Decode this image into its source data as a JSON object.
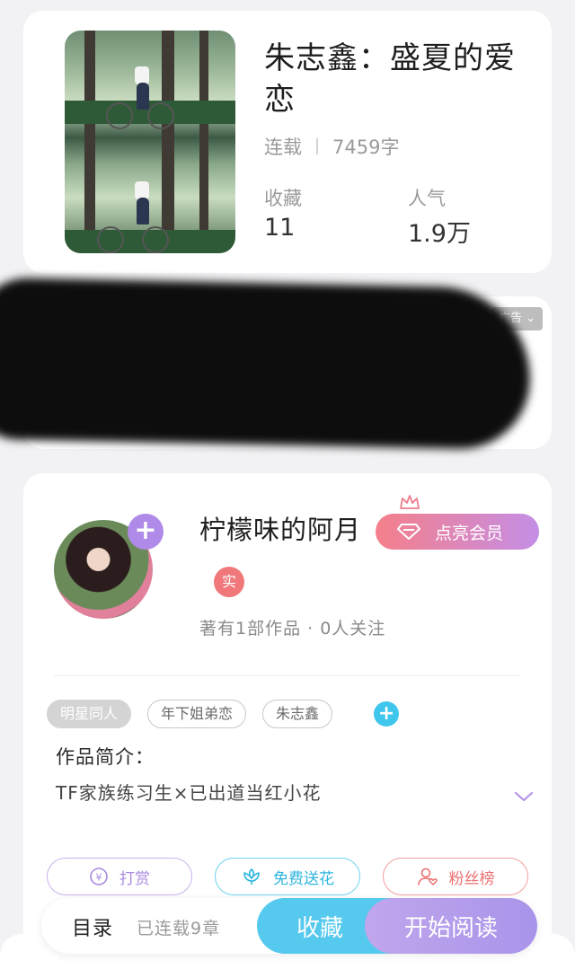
{
  "book": {
    "title": "朱志鑫：盛夏的爱恋",
    "status": "连载",
    "word_count": "7459字",
    "collect_label": "收藏",
    "collect_value": "11",
    "popularity_label": "人气",
    "popularity_value": "1.9万"
  },
  "ad": {
    "badge": "广告"
  },
  "author": {
    "name": "柠檬味的阿月",
    "vip_button": "点亮会员",
    "real_badge": "实",
    "stats": "著有1部作品 · 0人关注",
    "avatar_plus": "+"
  },
  "tags": [
    "明星同人",
    "年下姐弟恋",
    "朱志鑫"
  ],
  "tag_add": "+",
  "intro": {
    "label": "作品简介：",
    "text": "TF家族练习生×已出道当红小花"
  },
  "actions": {
    "reward": "打赏",
    "flower": "免费送花",
    "fans": "粉丝榜"
  },
  "bottom_bar": {
    "toc": "目录",
    "toc_status": "已连载9章",
    "collect": "收藏",
    "read": "开始阅读"
  },
  "colors": {
    "vip_start": "#f57f8a",
    "vip_end": "#c48ee6",
    "reward": "#b798e6",
    "flower": "#3fc6ec",
    "fans": "#f07c7c",
    "collect_btn": "#55c9ee",
    "read_btn": "#b49eeb"
  }
}
